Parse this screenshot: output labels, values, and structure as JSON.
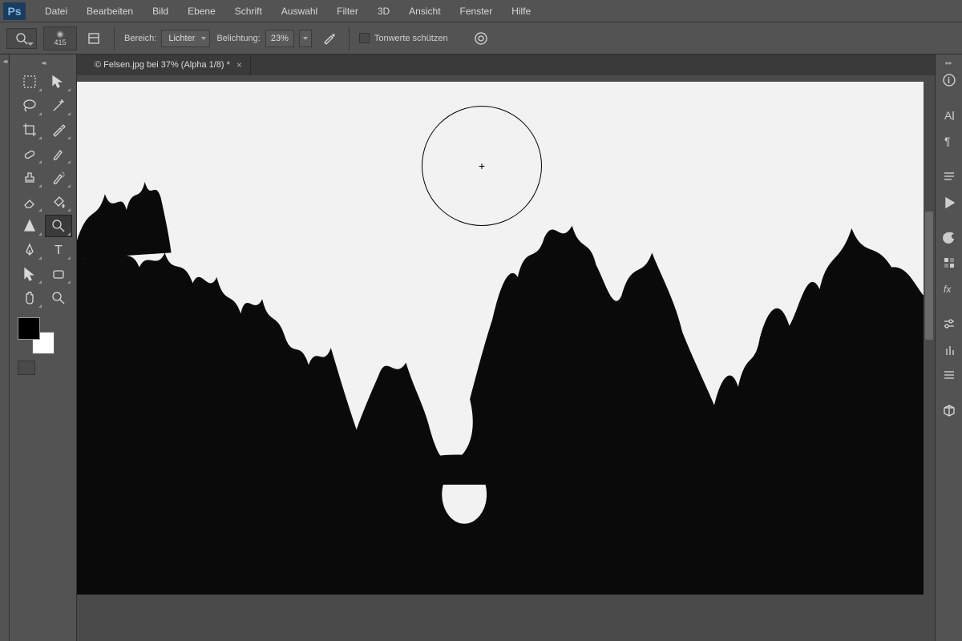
{
  "app": {
    "logo_text": "Ps"
  },
  "menu": {
    "items": [
      "Datei",
      "Bearbeiten",
      "Bild",
      "Ebene",
      "Schrift",
      "Auswahl",
      "Filter",
      "3D",
      "Ansicht",
      "Fenster",
      "Hilfe"
    ]
  },
  "options": {
    "brush_size": "415",
    "bereich_label": "Bereich:",
    "bereich_value": "Lichter",
    "belichtung_label": "Belichtung:",
    "belichtung_value": "23%",
    "protect_tones_label": "Tonwerte schützen"
  },
  "document": {
    "tab_title": "© Felsen.jpg bei 37% (Alpha 1/8) *",
    "close_glyph": "×"
  },
  "tools": {
    "left_column": [
      "marquee-tool",
      "lasso-tool",
      "crop-tool",
      "heal-tool",
      "stamp-tool",
      "eraser-tool",
      "dodge-tool",
      "pen-tool",
      "path-select-tool",
      "hand-tool"
    ],
    "right_column": [
      "move-tool",
      "wand-tool",
      "eyedropper-tool",
      "brush-tool",
      "history-brush-tool",
      "fill-tool",
      "burn-tool",
      "type-tool",
      "shape-tool",
      "zoom-tool"
    ]
  },
  "right_panels": [
    "info-icon",
    "character-icon",
    "paragraph-icon",
    "layers-icon",
    "play-icon",
    "color-icon",
    "swatches-icon",
    "fx-icon",
    "adjustments-icon",
    "brushes-icon",
    "presets-icon",
    "cube-icon"
  ],
  "brush_cursor": {
    "cross": "+"
  }
}
